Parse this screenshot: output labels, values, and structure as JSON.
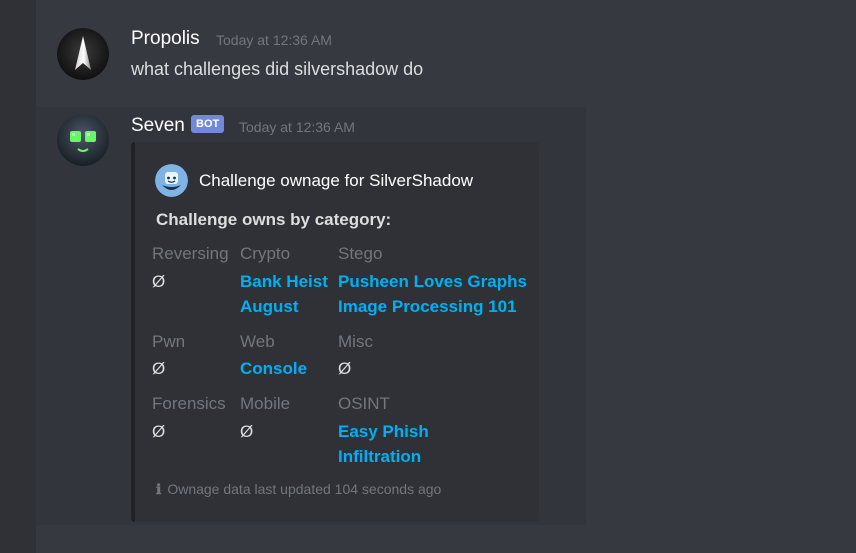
{
  "messages": [
    {
      "username": "Propolis",
      "timestamp": "Today at 12:36 AM",
      "text": "what challenges did silvershadow do"
    },
    {
      "username": "Seven",
      "badge": "BOT",
      "timestamp": "Today at 12:36 AM"
    }
  ],
  "embed": {
    "author": "Challenge ownage for SilverShadow",
    "description": "Challenge owns by category:",
    "fields": [
      {
        "name": "Reversing",
        "values": [
          "Ø"
        ]
      },
      {
        "name": "Crypto",
        "values": [
          "Bank Heist",
          "August"
        ]
      },
      {
        "name": "Stego",
        "values": [
          "Pusheen Loves Graphs",
          "Image Processing 101"
        ]
      },
      {
        "name": "Pwn",
        "values": [
          "Ø"
        ]
      },
      {
        "name": "Web",
        "values": [
          "Console"
        ]
      },
      {
        "name": "Misc",
        "values": [
          "Ø"
        ]
      },
      {
        "name": "Forensics",
        "values": [
          "Ø"
        ]
      },
      {
        "name": "Mobile",
        "values": [
          "Ø"
        ]
      },
      {
        "name": "OSINT",
        "values": [
          "Easy Phish",
          "Infiltration"
        ]
      }
    ],
    "footer_icon": "ℹ",
    "footer": "Ownage data last updated 104 seconds ago"
  },
  "colors": {
    "background": "#36393f",
    "embed_bg": "#2f3136",
    "link": "#00b0f4",
    "bot_badge": "#7289da",
    "muted": "#72767d"
  },
  "icons": {
    "propolis_avatar": "dark-spike-avatar-icon",
    "seven_avatar": "robot-face-avatar-icon",
    "embed_author_icon": "smiling-mascot-icon"
  }
}
